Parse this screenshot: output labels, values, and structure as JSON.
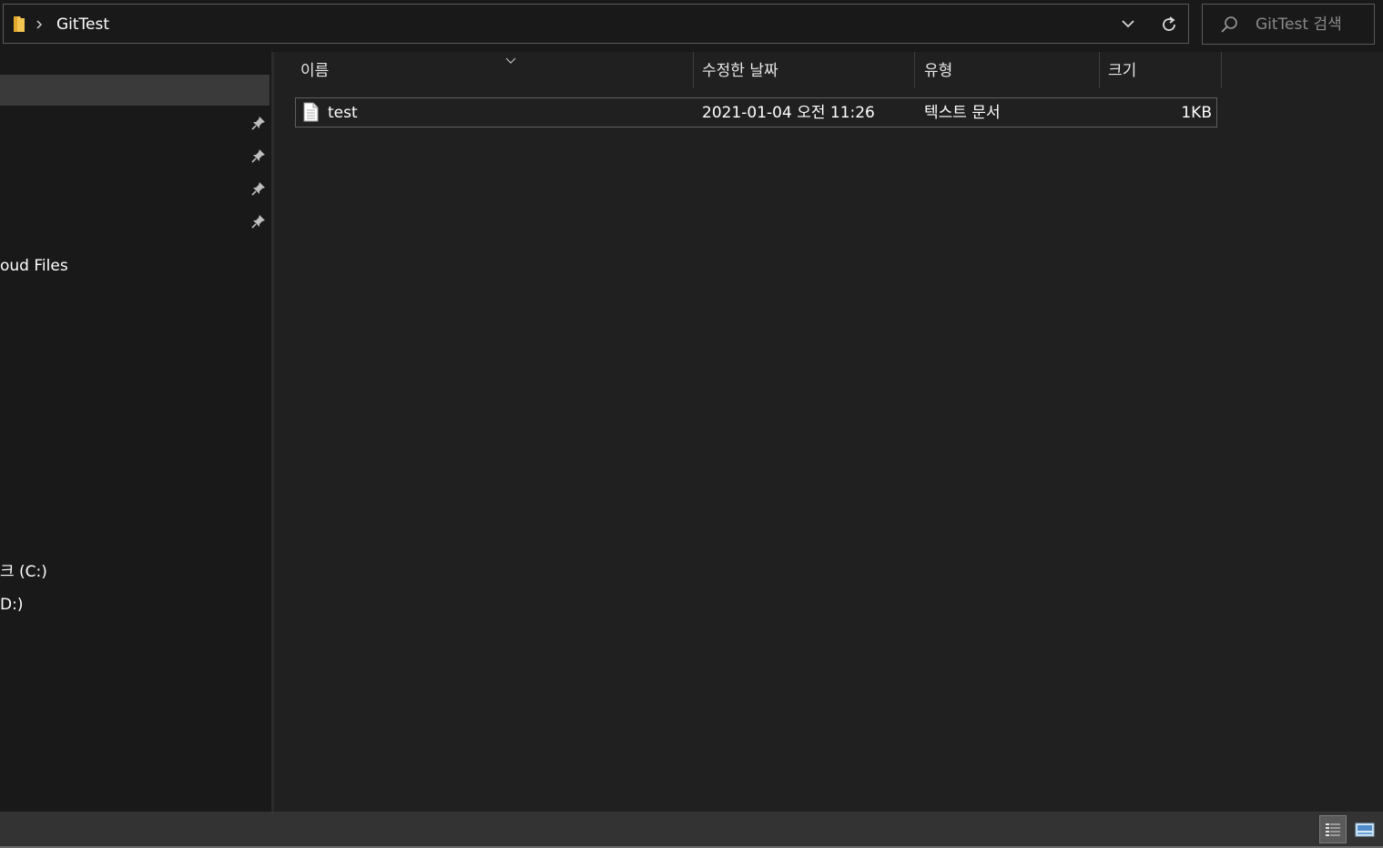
{
  "address_bar": {
    "folder_icon": "folder-icon",
    "separator_icon": "chevron-right-icon",
    "crumbs": [
      "GitTest"
    ],
    "dropdown_icon": "chevron-down-icon",
    "refresh_icon": "refresh-icon"
  },
  "search": {
    "placeholder": "GitTest 검색",
    "value": "",
    "icon": "search-icon"
  },
  "navigation": {
    "items": [
      {
        "label": "",
        "selected": true,
        "pinned": false
      },
      {
        "label": "",
        "pinned": true
      },
      {
        "label": "",
        "pinned": true
      },
      {
        "label": "",
        "pinned": true
      },
      {
        "label": "",
        "pinned": true
      },
      {
        "label": "oud Files",
        "pinned": false
      },
      {
        "label": "크 (C:)",
        "pinned": false
      },
      {
        "label": "D:)",
        "pinned": false
      }
    ]
  },
  "columns": {
    "name": "이름",
    "modified": "수정한 날짜",
    "type": "유형",
    "size": "크기"
  },
  "files": [
    {
      "name": "test",
      "modified": "2021-01-04 오전 11:26",
      "type": "텍스트 문서",
      "size": "1KB",
      "icon": "text-file-icon"
    }
  ],
  "status_bar": {
    "view_buttons": [
      {
        "icon": "details-view-icon",
        "active": true
      },
      {
        "icon": "large-icons-view-icon",
        "active": false
      }
    ]
  },
  "colors": {
    "background": "#191919",
    "content_background": "#202020",
    "status_bar": "#333333",
    "folder_yellow": "#f3c44f"
  }
}
